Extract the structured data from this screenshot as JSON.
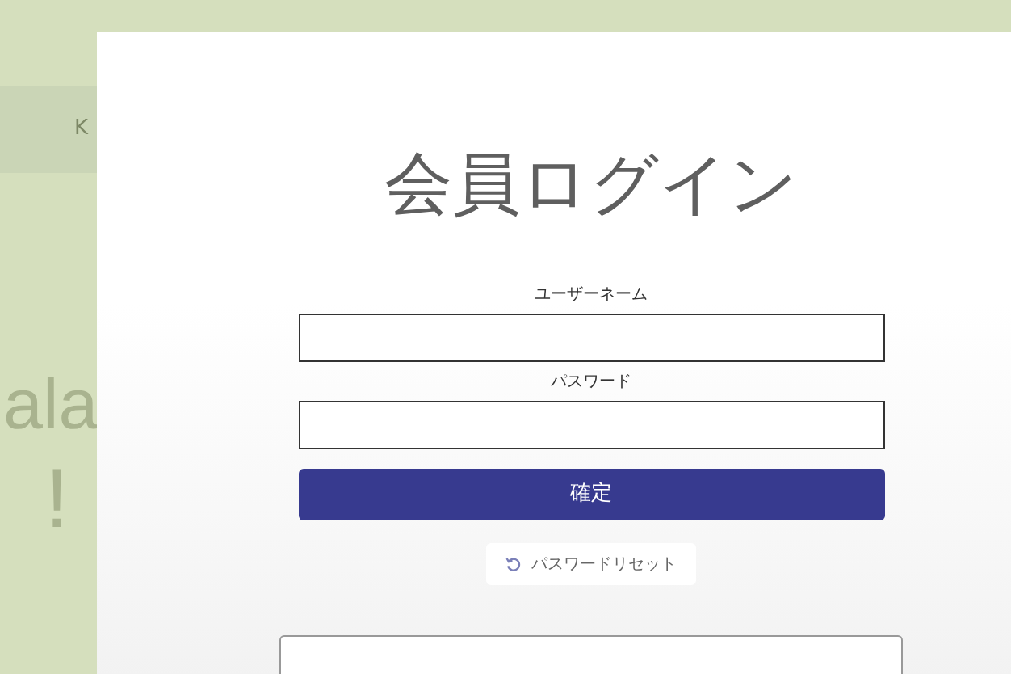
{
  "background_page": {
    "nav_text": "K",
    "heading": "ala",
    "subheading": "!"
  },
  "login_dialog": {
    "title": "会員ログイン",
    "fields": [
      {
        "label": "ユーザーネーム"
      },
      {
        "label": "パスワード"
      }
    ],
    "submit_button": "確定",
    "reset_link": "パスワードリセット"
  }
}
